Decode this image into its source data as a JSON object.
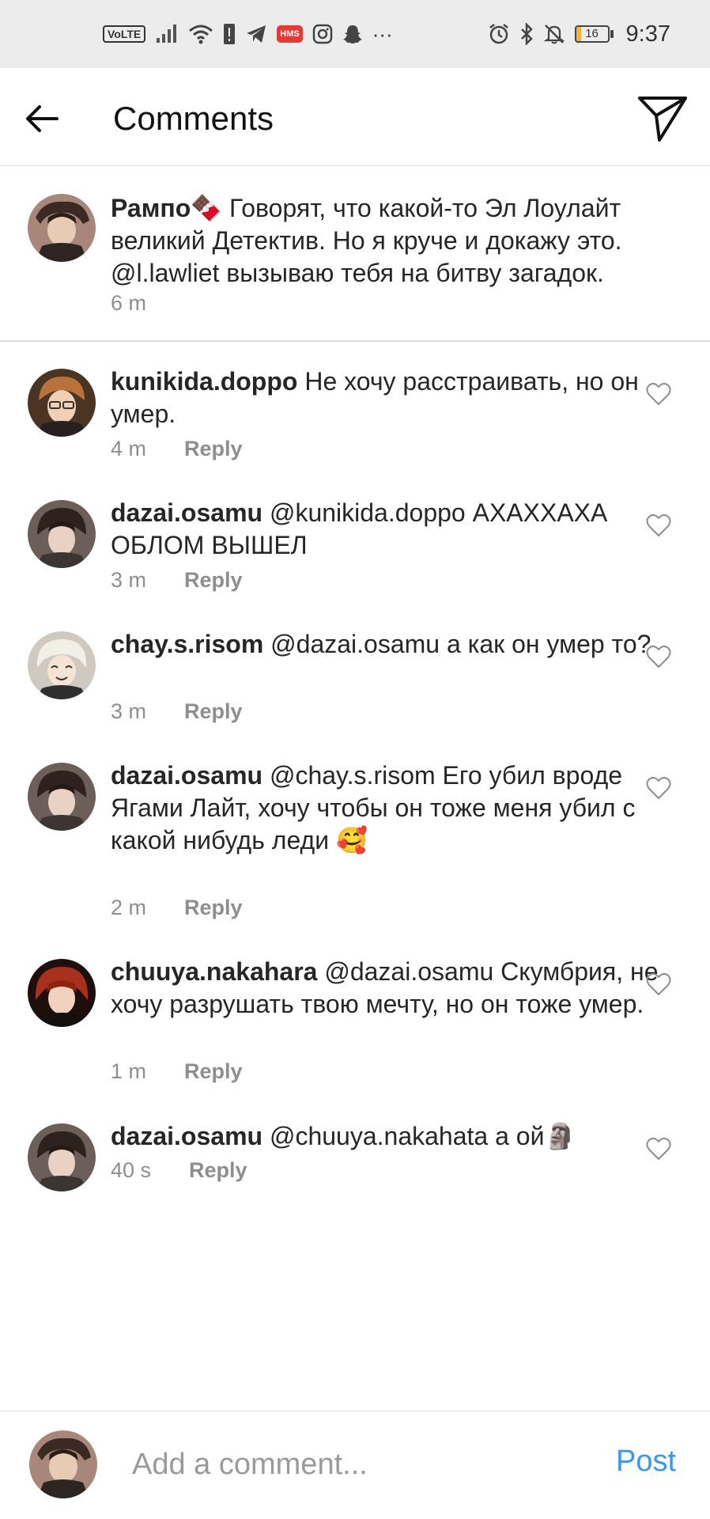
{
  "status_bar": {
    "volte": "VoLTE",
    "hms": "HMS",
    "more": "···",
    "battery_level": "16",
    "battery_fraction": 0.16,
    "time": "9:37"
  },
  "header": {
    "title": "Comments",
    "back_icon": "arrow-left-icon",
    "direct_icon": "paper-plane-icon"
  },
  "caption": {
    "username": "Рампо🍫",
    "text": " Говорят, что какой-то Эл Лоулайт великий Детектив. Но я круче и докажу это. @l.lawliet вызываю тебя на битву загадок.",
    "time": "6 m"
  },
  "reply_label": "Reply",
  "comments": [
    {
      "username": "kunikida.doppo",
      "text": " Не хочу расстраивать, но он умер.",
      "time": "4 m"
    },
    {
      "username": "dazai.osamu",
      "text": " @kunikida.doppo АХАХХАХА ОБЛОМ ВЫШЕЛ",
      "time": "3 m"
    },
    {
      "username": "chay.s.risom",
      "text": " @dazai.osamu а как он умер то?",
      "time": "3 m"
    },
    {
      "username": "dazai.osamu",
      "text": " @chay.s.risom Его убил вроде Ягами Лайт, хочу чтобы он тоже меня убил с какой нибудь леди 🥰",
      "time": "2 m"
    },
    {
      "username": "chuuya.nakahara",
      "text": " @dazai.osamu Скумбрия, не хочу разрушать твою мечту, но он тоже умер.",
      "time": "1 m"
    },
    {
      "username": "dazai.osamu",
      "text": " @chuuya.nakahata а ой🗿",
      "time": "40 s"
    }
  ],
  "input": {
    "placeholder": "Add a comment...",
    "post_label": "Post"
  },
  "colors": {
    "accent": "#3897f0",
    "muted_text": "#8e8e8e",
    "status_bar_bg": "#ececec"
  }
}
